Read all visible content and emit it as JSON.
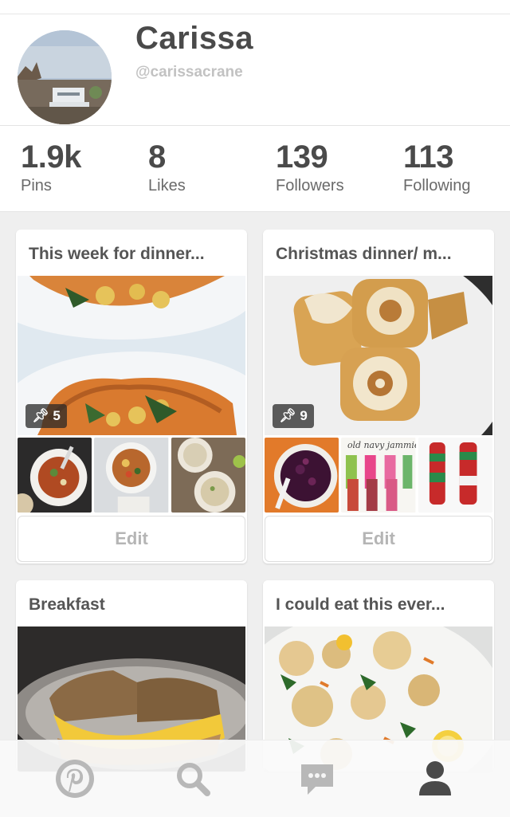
{
  "profile": {
    "name": "Carissa",
    "username": "@carissacrane"
  },
  "stats": [
    {
      "value": "1.9k",
      "label": "Pins"
    },
    {
      "value": "8",
      "label": "Likes"
    },
    {
      "value": "139",
      "label": "Followers"
    },
    {
      "value": "113",
      "label": "Following"
    }
  ],
  "boards": [
    {
      "title": "This week for dinner...",
      "pin_count": "5",
      "edit_label": "Edit"
    },
    {
      "title": "Christmas dinner/ m...",
      "pin_count": "9",
      "edit_label": "Edit"
    },
    {
      "title": "Breakfast"
    },
    {
      "title": "I could eat this ever..."
    }
  ],
  "thumbnail_texts": {
    "pajama_caption": "old navy jammies"
  },
  "tabbar": {
    "items": [
      {
        "icon": "pinterest-logo-icon"
      },
      {
        "icon": "search-icon"
      },
      {
        "icon": "messages-icon"
      },
      {
        "icon": "profile-icon",
        "active": true
      }
    ],
    "active_color": "#4a4a4a",
    "inactive_color": "#b8b8b8"
  },
  "colors": {
    "text_primary": "#4a4a4a",
    "text_muted": "#c2c2c2",
    "background": "#efefef"
  }
}
